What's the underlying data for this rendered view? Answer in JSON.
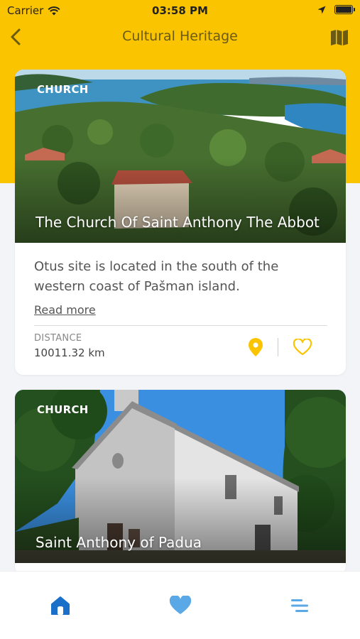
{
  "status_bar": {
    "carrier": "Carrier",
    "time": "03:58 PM"
  },
  "nav": {
    "title": "Cultural Heritage"
  },
  "cards": [
    {
      "category": "CHURCH",
      "title": "The Church Of Saint Anthony The Abbot",
      "description": "Otus site is located in the south of the western coast of Pašman island.",
      "read_more": "Read more",
      "distance_label": "DISTANCE",
      "distance_value": "10011.32 km"
    },
    {
      "category": "CHURCH",
      "title": "Saint Anthony of Padua"
    }
  ],
  "colors": {
    "accent": "#fbc400",
    "tab_active": "#1a6fc9",
    "tab_inactive": "#5aa9e6"
  },
  "icons": [
    "back-arrow-icon",
    "map-icon",
    "location-pin-icon",
    "heart-outline-icon",
    "home-icon",
    "heart-icon",
    "menu-icon"
  ]
}
